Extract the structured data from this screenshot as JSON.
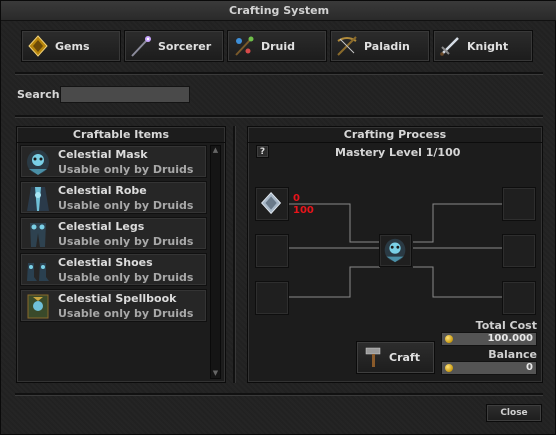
{
  "window": {
    "title": "Crafting System"
  },
  "tabs": [
    {
      "label": "Gems",
      "icon": "gem-icon"
    },
    {
      "label": "Sorcerer",
      "icon": "wand-icon"
    },
    {
      "label": "Druid",
      "icon": "rod-icon"
    },
    {
      "label": "Paladin",
      "icon": "crossbow-icon"
    },
    {
      "label": "Knight",
      "icon": "sword-icon"
    }
  ],
  "search": {
    "label": "Search",
    "value": ""
  },
  "craftable": {
    "title": "Craftable Items",
    "items": [
      {
        "name": "Celestial Mask",
        "desc": "Usable only by Druids",
        "icon": "mask-icon"
      },
      {
        "name": "Celestial Robe",
        "desc": "Usable only by Druids",
        "icon": "robe-icon"
      },
      {
        "name": "Celestial Legs",
        "desc": "Usable only by Druids",
        "icon": "legs-icon"
      },
      {
        "name": "Celestial Shoes",
        "desc": "Usable only by Druids",
        "icon": "shoes-icon"
      },
      {
        "name": "Celestial Spellbook",
        "desc": "Usable only by Druids",
        "icon": "spellbook-icon"
      }
    ]
  },
  "process": {
    "title": "Crafting Process",
    "help": "?",
    "mastery": "Mastery Level 1/100",
    "material_have": "0",
    "material_need": "100",
    "craft_label": "Craft",
    "total_cost_label": "Total Cost",
    "total_cost": "100.000",
    "balance_label": "Balance",
    "balance": "0"
  },
  "footer": {
    "close_label": "Close"
  },
  "colors": {
    "accent_red": "#e8141a",
    "gold": "#d4a017",
    "panel_bg": "#1c1c1c"
  }
}
